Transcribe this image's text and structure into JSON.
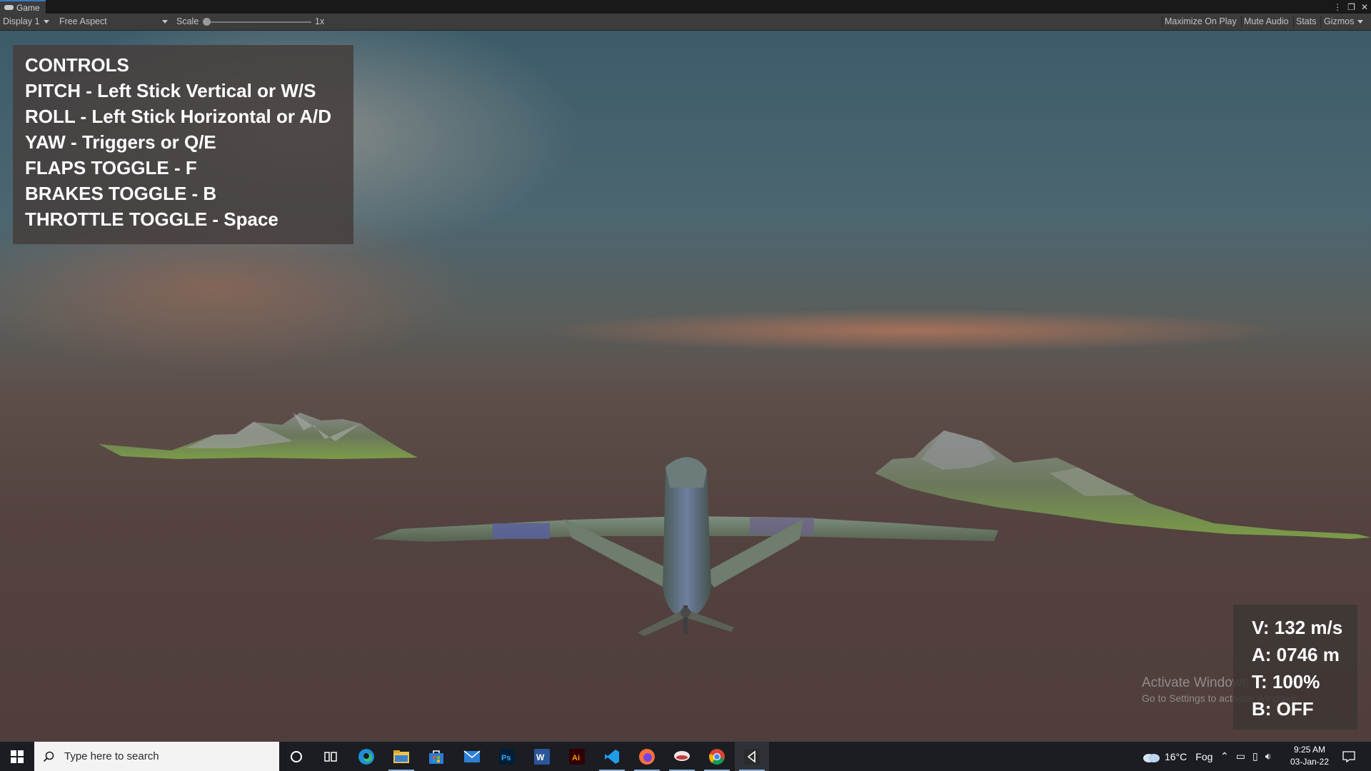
{
  "editor": {
    "tab_label": "Game",
    "display": "Display 1",
    "aspect": "Free Aspect",
    "scale_label": "Scale",
    "scale_value": "1x",
    "maximize_on_play": "Maximize On Play",
    "mute_audio": "Mute Audio",
    "stats": "Stats",
    "gizmos": "Gizmos"
  },
  "controls": {
    "title": "CONTROLS",
    "lines": [
      "PITCH - Left Stick Vertical or W/S",
      "ROLL - Left Stick Horizontal or A/D",
      "YAW - Triggers or Q/E",
      "FLAPS TOGGLE - F",
      "BRAKES TOGGLE - B",
      "THROTTLE TOGGLE - Space"
    ]
  },
  "hud": {
    "velocity": "V: 132 m/s",
    "altitude": "A: 0746 m",
    "throttle": "T: 100%",
    "brakes": "B: OFF"
  },
  "watermark": {
    "line1": "Activate Windows",
    "line2": "Go to Settings to activate Windows."
  },
  "taskbar": {
    "search_placeholder": "Type here to search",
    "apps": [
      "cortana-icon",
      "task-view-icon",
      "edge-icon",
      "file-explorer-icon",
      "store-icon",
      "mail-icon",
      "photoshop-icon",
      "word-icon",
      "illustrator-icon",
      "vscode-icon",
      "firefox-icon",
      "game-app-icon",
      "chrome-icon",
      "unity-icon"
    ],
    "weather_temp": "16°C",
    "weather_desc": "Fog",
    "time": "9:25 AM",
    "date": "03-Jan-22"
  }
}
